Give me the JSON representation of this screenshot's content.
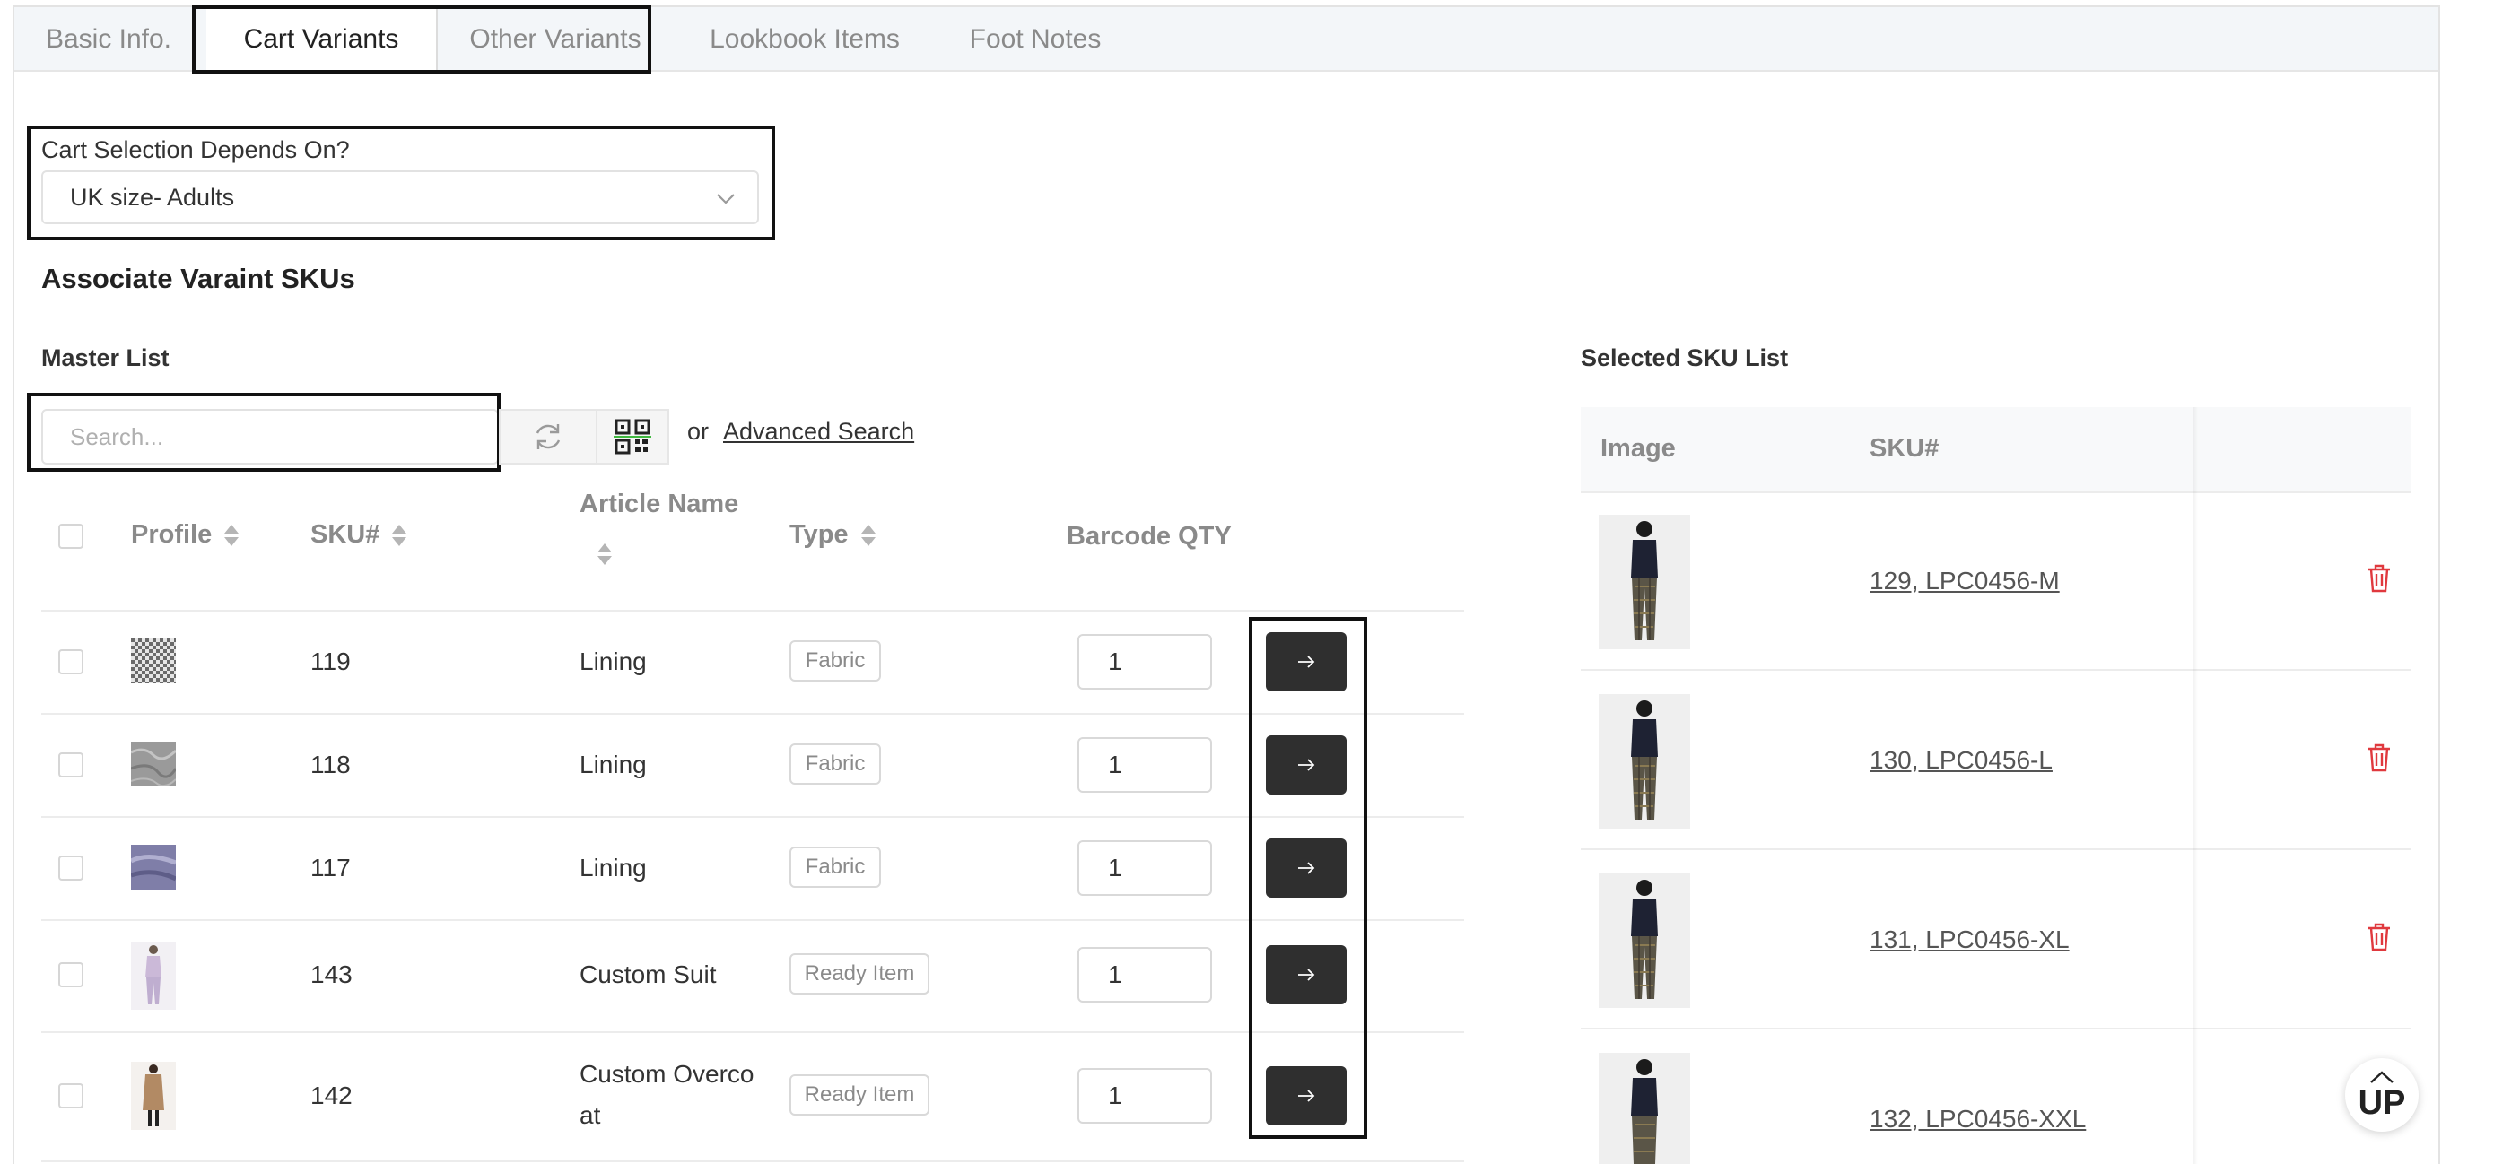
{
  "tabs": [
    {
      "label": "Basic Info."
    },
    {
      "label": "Cart Variants"
    },
    {
      "label": "Other Variants"
    },
    {
      "label": "Lookbook Items"
    },
    {
      "label": "Foot Notes"
    }
  ],
  "active_tab": "Cart Variants",
  "cart_selection": {
    "label": "Cart Selection Depends On?",
    "value": "UK size- Adults"
  },
  "section_title": "Associate Varaint SKUs",
  "master_list": {
    "title": "Master List",
    "search_placeholder": "Search...",
    "or_text": "or",
    "advanced_search": "Advanced Search",
    "columns": {
      "profile": "Profile",
      "sku": "SKU#",
      "article_name": "Article Name",
      "type": "Type",
      "barcode_qty": "Barcode QTY"
    },
    "rows": [
      {
        "sku": "119",
        "article": "Lining",
        "type": "Fabric",
        "qty": "1",
        "thumb": "checkered-fabric"
      },
      {
        "sku": "118",
        "article": "Lining",
        "type": "Fabric",
        "qty": "1",
        "thumb": "grey-marble-fabric"
      },
      {
        "sku": "117",
        "article": "Lining",
        "type": "Fabric",
        "qty": "1",
        "thumb": "lavender-silk-fabric"
      },
      {
        "sku": "143",
        "article": "Custom Suit",
        "type": "Ready Item",
        "qty": "1",
        "thumb": "suit-figure"
      },
      {
        "sku": "142",
        "article_line1": "Custom Overco",
        "article_line2": "at",
        "type": "Ready Item",
        "qty": "1",
        "thumb": "overcoat-figure"
      }
    ]
  },
  "selected_list": {
    "title": "Selected SKU List",
    "columns": {
      "image": "Image",
      "sku": "SKU#"
    },
    "rows": [
      {
        "sku": "129, LPC0456-M"
      },
      {
        "sku": "130, LPC0456-L"
      },
      {
        "sku": "131, LPC0456-XL"
      },
      {
        "sku": "132, LPC0456-XXL"
      }
    ]
  },
  "scroll_up_label": "UP",
  "colors": {
    "delete": "#e0393e",
    "button_dark": "#2f2f2f",
    "tab_bar": "#f3f6f9"
  }
}
